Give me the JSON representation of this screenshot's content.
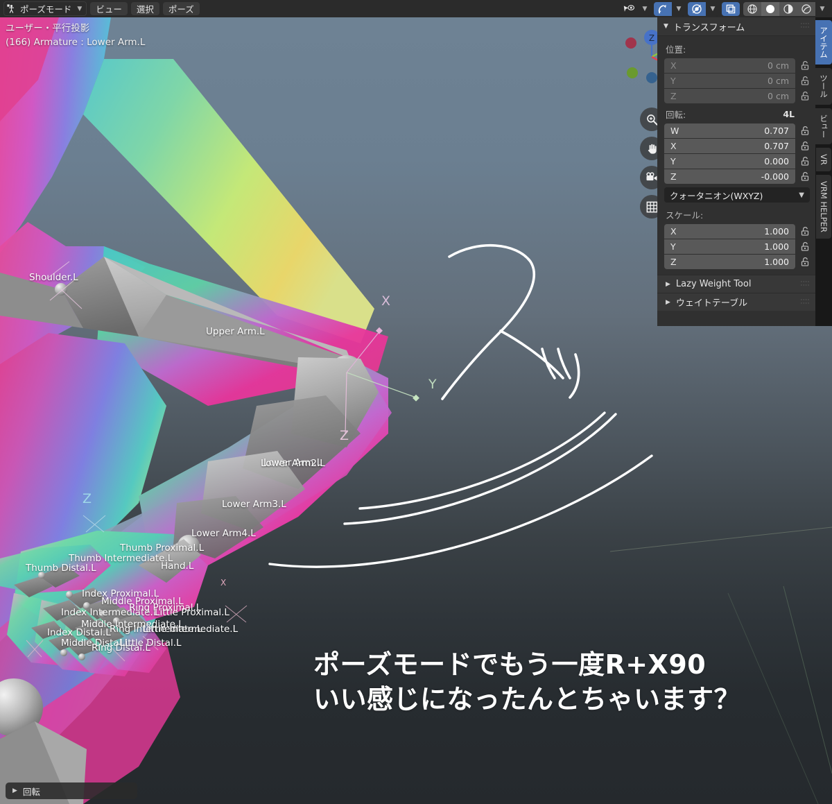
{
  "header": {
    "mode_button": {
      "label": "ポーズモード",
      "icon": "pose-mode-icon"
    },
    "menus": [
      "ビュー",
      "選択",
      "ポーズ"
    ],
    "right_tools": [
      {
        "name": "visibility-selectability-icon",
        "active": false,
        "dropdown": true
      },
      {
        "name": "snap-magnet-icon",
        "active": true,
        "dropdown": true
      },
      {
        "name": "proportional-edit-icon",
        "active": true,
        "dropdown": true
      },
      {
        "name": "xray-toggle-icon",
        "active": true,
        "dropdown": false
      },
      {
        "name": "shading-wireframe-icon",
        "active": false,
        "dropdown": false
      },
      {
        "name": "shading-solid-icon",
        "active": true,
        "dropdown": false
      },
      {
        "name": "shading-material-icon",
        "active": false,
        "dropdown": false
      },
      {
        "name": "shading-rendered-icon",
        "active": false,
        "dropdown": true
      }
    ]
  },
  "viewport": {
    "view_name": "ユーザー・平行投影",
    "object_info": "(166) Armature : Lower Arm.L",
    "gizmo_axes": [
      {
        "label": "Z",
        "color": "#4772c8"
      },
      {
        "label": "Y",
        "color": "#8ec63f"
      },
      {
        "label": "X",
        "color": "#e8404e"
      }
    ],
    "nav_buttons": [
      "zoom-icon",
      "pan-hand-icon",
      "camera-view-icon",
      "toggle-ortho-grid-icon"
    ],
    "bone_axis_letters": [
      {
        "label": "X",
        "color": "#d8bcd8"
      },
      {
        "label": "Y",
        "color": "#bcd8bc"
      },
      {
        "label": "Z",
        "color": "#e6c4da"
      },
      {
        "label": "Z",
        "color": "#9fd8e8"
      },
      {
        "label": "Z",
        "color": "#d8bcd8"
      },
      {
        "label": "X",
        "color": "#e0a8bd"
      }
    ],
    "bone_labels": [
      "Shoulder.L",
      "Upper Arm.L",
      "Lower Arm.L",
      "Lower Arm2.L",
      "Lower Arm3.L",
      "Lower Arm4.L",
      "Hand.L",
      "Thumb Proximal.L",
      "Thumb Intermediate.L",
      "Thumb Distal.L",
      "Index Proximal.L",
      "Index Intermediate.L",
      "Index Distal.L",
      "Middle Proximal.L",
      "Middle Intermediate.L",
      "Middle Distal.L",
      "Ring Proximal.L",
      "Ring Intermediate.L",
      "Ring Distal.L",
      "Little Proximal.L",
      "Little Intermediate.L",
      "Little Distal.L"
    ],
    "annotation_sfx": "スッ",
    "caption_lines": [
      "ポーズモードでもう一度R+X90",
      "いい感じになったんとちゃいます？"
    ]
  },
  "operator_panel": {
    "label": "回転",
    "expand_icon": "triangle-right-icon"
  },
  "sidebar": {
    "tabs": [
      {
        "label": "アイテム",
        "active": true
      },
      {
        "label": "ツール",
        "active": false
      },
      {
        "label": "ビュー",
        "active": false
      },
      {
        "label": "VR",
        "active": false
      },
      {
        "label": "VRM HELPER",
        "active": false
      }
    ],
    "transform_panel": {
      "title": "トランスフォーム",
      "location": {
        "label": "位置:",
        "fields": [
          {
            "axis": "X",
            "value": "0 cm",
            "locked": false
          },
          {
            "axis": "Y",
            "value": "0 cm",
            "locked": false
          },
          {
            "axis": "Z",
            "value": "0 cm",
            "locked": false
          }
        ]
      },
      "rotation": {
        "label": "回転:",
        "mode_indicator": "4L",
        "fields": [
          {
            "axis": "W",
            "value": "0.707",
            "locked": false
          },
          {
            "axis": "X",
            "value": "0.707",
            "locked": false
          },
          {
            "axis": "Y",
            "value": "0.000",
            "locked": false
          },
          {
            "axis": "Z",
            "value": "-0.000",
            "locked": false
          }
        ],
        "mode_dropdown": "クォータニオン(WXYZ)"
      },
      "scale": {
        "label": "スケール:",
        "fields": [
          {
            "axis": "X",
            "value": "1.000",
            "locked": false
          },
          {
            "axis": "Y",
            "value": "1.000",
            "locked": false
          },
          {
            "axis": "Z",
            "value": "1.000",
            "locked": false
          }
        ]
      }
    },
    "sub_panels": [
      {
        "title": "Lazy Weight Tool"
      },
      {
        "title": "ウェイトテーブル"
      }
    ]
  },
  "colors": {
    "accent_blue": "#4772b3",
    "panel_bg": "#303030",
    "header_bg": "#2b2b2b",
    "viewport_top": "#6e8294",
    "viewport_bottom": "#25292d"
  }
}
